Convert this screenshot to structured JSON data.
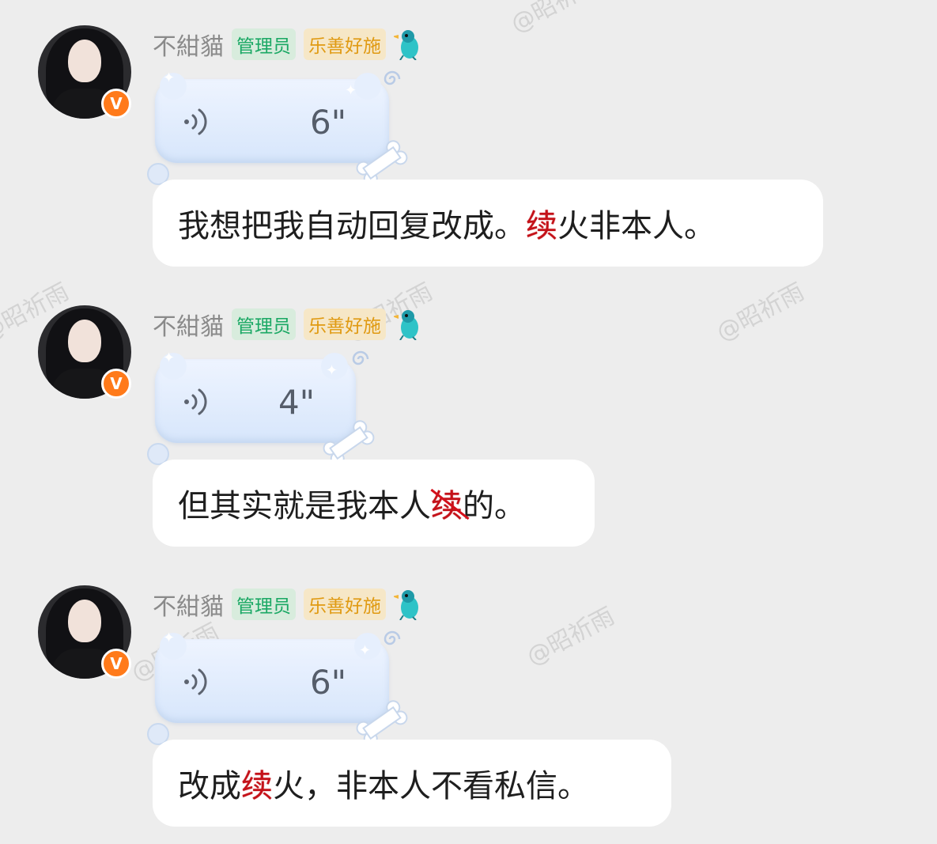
{
  "watermark": "@昭祈雨",
  "messages": [
    {
      "username": "不紺貓",
      "tags": {
        "admin": "管理员",
        "charity": "乐善好施"
      },
      "voice_duration": "6\"",
      "text_before": "我想把我自动回复改成。",
      "text_highlight": "续",
      "text_after": "火非本人。"
    },
    {
      "username": "不紺貓",
      "tags": {
        "admin": "管理员",
        "charity": "乐善好施"
      },
      "voice_duration": "4\"",
      "text_before": "但其实就是我本人",
      "text_highlight": "续",
      "text_after": "的。"
    },
    {
      "username": "不紺貓",
      "tags": {
        "admin": "管理员",
        "charity": "乐善好施"
      },
      "voice_duration": "6\"",
      "text_before": "改成",
      "text_highlight": "续",
      "text_after": "火，非本人不看私信。"
    }
  ],
  "verified_badge": "V",
  "colors": {
    "background": "#ededed",
    "admin_tag": "#1aa864",
    "charity_tag": "#e09a12",
    "highlight": "#c41219",
    "verified": "#ff7a1a"
  }
}
